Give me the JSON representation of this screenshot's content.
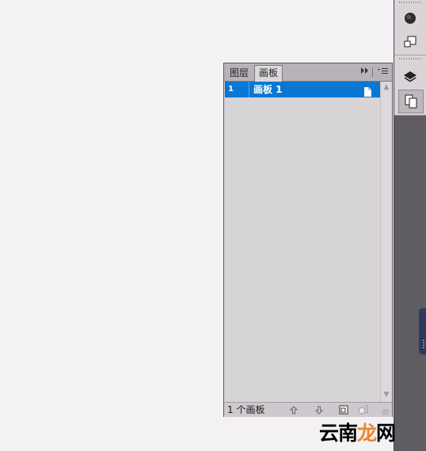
{
  "panel": {
    "tabs": [
      {
        "label": "图层",
        "active": false
      },
      {
        "label": "画板",
        "active": true
      }
    ],
    "tab_controls": {
      "collapse_icon": "double-chevron-right-icon",
      "menu_icon": "panel-menu-icon"
    },
    "artboards": [
      {
        "number": "1",
        "name": "画板 1",
        "selected": true,
        "icon": "document-icon"
      }
    ],
    "footer": {
      "count_label": "1 个画板",
      "buttons": [
        "move-up-icon",
        "move-down-icon",
        "new-artboard-icon",
        "delete-icon"
      ]
    }
  },
  "dock": {
    "buttons": [
      "color-icon",
      "transform-icon",
      "layers-icon",
      "artboards-icon"
    ],
    "active": "artboards-icon"
  },
  "watermark": {
    "prefix": "云南",
    "accent": "龙",
    "suffix": "网"
  },
  "colors": {
    "selection": "#0a77d2",
    "dock": "#5f5c62",
    "canvas": "#f4f1f5",
    "accent": "#e8872a"
  }
}
